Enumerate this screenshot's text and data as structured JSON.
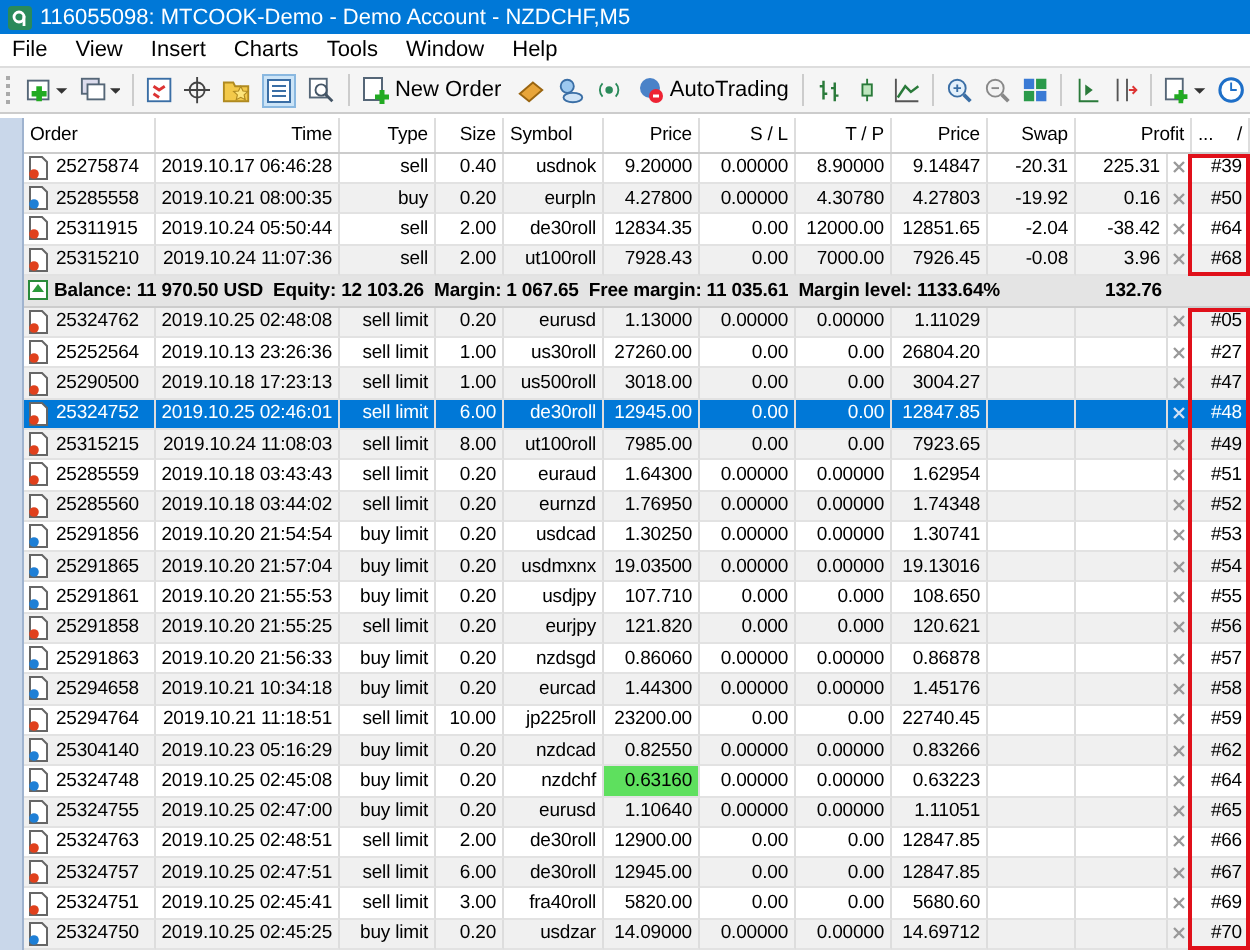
{
  "window": {
    "title": "116055098: MTCOOK-Demo - Demo Account - NZDCHF,M5"
  },
  "menu": [
    "File",
    "View",
    "Insert",
    "Charts",
    "Tools",
    "Window",
    "Help"
  ],
  "toolbar": {
    "new_order": "New Order",
    "auto_trading": "AutoTrading",
    "terminal_pressed": true
  },
  "table": {
    "columns": [
      "Order",
      "Time",
      "Type",
      "Size",
      "Symbol",
      "Price",
      "S / L",
      "T / P",
      "Price",
      "Swap",
      "Profit",
      "..."
    ],
    "sort_marker": "/",
    "open_positions": [
      {
        "order": "25275874",
        "time": "2019.10.17 06:46:28",
        "type": "sell",
        "kind": "sell",
        "size": "0.40",
        "symbol": "usdnok",
        "price": "9.20000",
        "sl": "0.00000",
        "tp": "8.90000",
        "current": "9.14847",
        "swap": "-20.31",
        "profit": "225.31",
        "comment": "#39"
      },
      {
        "order": "25285558",
        "time": "2019.10.21 08:00:35",
        "type": "buy",
        "kind": "buy",
        "size": "0.20",
        "symbol": "eurpln",
        "price": "4.27800",
        "sl": "0.00000",
        "tp": "4.30780",
        "current": "4.27803",
        "swap": "-19.92",
        "profit": "0.16",
        "comment": "#50"
      },
      {
        "order": "25311915",
        "time": "2019.10.24 05:50:44",
        "type": "sell",
        "kind": "sell",
        "size": "2.00",
        "symbol": "de30roll",
        "price": "12834.35",
        "sl": "0.00",
        "tp": "12000.00",
        "current": "12851.65",
        "swap": "-2.04",
        "profit": "-38.42",
        "comment": "#64"
      },
      {
        "order": "25315210",
        "time": "2019.10.24 11:07:36",
        "type": "sell",
        "kind": "sell",
        "size": "2.00",
        "symbol": "ut100roll",
        "price": "7928.43",
        "sl": "0.00",
        "tp": "7000.00",
        "current": "7926.45",
        "swap": "-0.08",
        "profit": "3.96",
        "comment": "#68"
      }
    ],
    "balance": {
      "text": "Balance: 11 970.50 USD  Equity: 12 103.26  Margin: 1 067.65  Free margin: 11 035.61  Margin level: 1133.64%",
      "profit": "132.76"
    },
    "pending_orders": [
      {
        "order": "25324762",
        "time": "2019.10.25 02:48:08",
        "type": "sell limit",
        "kind": "sell",
        "size": "0.20",
        "symbol": "eurusd",
        "price": "1.13000",
        "sl": "0.00000",
        "tp": "0.00000",
        "current": "1.11029",
        "comment": "#05",
        "selected": false,
        "price_flash": false
      },
      {
        "order": "25252564",
        "time": "2019.10.13 23:26:36",
        "type": "sell limit",
        "kind": "sell",
        "size": "1.00",
        "symbol": "us30roll",
        "price": "27260.00",
        "sl": "0.00",
        "tp": "0.00",
        "current": "26804.20",
        "comment": "#27",
        "selected": false,
        "price_flash": false
      },
      {
        "order": "25290500",
        "time": "2019.10.18 17:23:13",
        "type": "sell limit",
        "kind": "sell",
        "size": "1.00",
        "symbol": "us500roll",
        "price": "3018.00",
        "sl": "0.00",
        "tp": "0.00",
        "current": "3004.27",
        "comment": "#47",
        "selected": false,
        "price_flash": false
      },
      {
        "order": "25324752",
        "time": "2019.10.25 02:46:01",
        "type": "sell limit",
        "kind": "sell",
        "size": "6.00",
        "symbol": "de30roll",
        "price": "12945.00",
        "sl": "0.00",
        "tp": "0.00",
        "current": "12847.85",
        "comment": "#48",
        "selected": true,
        "price_flash": false
      },
      {
        "order": "25315215",
        "time": "2019.10.24 11:08:03",
        "type": "sell limit",
        "kind": "sell",
        "size": "8.00",
        "symbol": "ut100roll",
        "price": "7985.00",
        "sl": "0.00",
        "tp": "0.00",
        "current": "7923.65",
        "comment": "#49",
        "selected": false,
        "price_flash": false
      },
      {
        "order": "25285559",
        "time": "2019.10.18 03:43:43",
        "type": "sell limit",
        "kind": "sell",
        "size": "0.20",
        "symbol": "euraud",
        "price": "1.64300",
        "sl": "0.00000",
        "tp": "0.00000",
        "current": "1.62954",
        "comment": "#51",
        "selected": false,
        "price_flash": false
      },
      {
        "order": "25285560",
        "time": "2019.10.18 03:44:02",
        "type": "sell limit",
        "kind": "sell",
        "size": "0.20",
        "symbol": "eurnzd",
        "price": "1.76950",
        "sl": "0.00000",
        "tp": "0.00000",
        "current": "1.74348",
        "comment": "#52",
        "selected": false,
        "price_flash": false
      },
      {
        "order": "25291856",
        "time": "2019.10.20 21:54:54",
        "type": "buy limit",
        "kind": "buy",
        "size": "0.20",
        "symbol": "usdcad",
        "price": "1.30250",
        "sl": "0.00000",
        "tp": "0.00000",
        "current": "1.30741",
        "comment": "#53",
        "selected": false,
        "price_flash": false
      },
      {
        "order": "25291865",
        "time": "2019.10.20 21:57:04",
        "type": "buy limit",
        "kind": "buy",
        "size": "0.20",
        "symbol": "usdmxnx",
        "price": "19.03500",
        "sl": "0.00000",
        "tp": "0.00000",
        "current": "19.13016",
        "comment": "#54",
        "selected": false,
        "price_flash": false
      },
      {
        "order": "25291861",
        "time": "2019.10.20 21:55:53",
        "type": "buy limit",
        "kind": "buy",
        "size": "0.20",
        "symbol": "usdjpy",
        "price": "107.710",
        "sl": "0.000",
        "tp": "0.000",
        "current": "108.650",
        "comment": "#55",
        "selected": false,
        "price_flash": false
      },
      {
        "order": "25291858",
        "time": "2019.10.20 21:55:25",
        "type": "sell limit",
        "kind": "sell",
        "size": "0.20",
        "symbol": "eurjpy",
        "price": "121.820",
        "sl": "0.000",
        "tp": "0.000",
        "current": "120.621",
        "comment": "#56",
        "selected": false,
        "price_flash": false
      },
      {
        "order": "25291863",
        "time": "2019.10.20 21:56:33",
        "type": "buy limit",
        "kind": "buy",
        "size": "0.20",
        "symbol": "nzdsgd",
        "price": "0.86060",
        "sl": "0.00000",
        "tp": "0.00000",
        "current": "0.86878",
        "comment": "#57",
        "selected": false,
        "price_flash": false
      },
      {
        "order": "25294658",
        "time": "2019.10.21 10:34:18",
        "type": "buy limit",
        "kind": "buy",
        "size": "0.20",
        "symbol": "eurcad",
        "price": "1.44300",
        "sl": "0.00000",
        "tp": "0.00000",
        "current": "1.45176",
        "comment": "#58",
        "selected": false,
        "price_flash": false
      },
      {
        "order": "25294764",
        "time": "2019.10.21 11:18:51",
        "type": "sell limit",
        "kind": "sell",
        "size": "10.00",
        "symbol": "jp225roll",
        "price": "23200.00",
        "sl": "0.00",
        "tp": "0.00",
        "current": "22740.45",
        "comment": "#59",
        "selected": false,
        "price_flash": false
      },
      {
        "order": "25304140",
        "time": "2019.10.23 05:16:29",
        "type": "buy limit",
        "kind": "buy",
        "size": "0.20",
        "symbol": "nzdcad",
        "price": "0.82550",
        "sl": "0.00000",
        "tp": "0.00000",
        "current": "0.83266",
        "comment": "#62",
        "selected": false,
        "price_flash": false
      },
      {
        "order": "25324748",
        "time": "2019.10.25 02:45:08",
        "type": "buy limit",
        "kind": "buy",
        "size": "0.20",
        "symbol": "nzdchf",
        "price": "0.63160",
        "sl": "0.00000",
        "tp": "0.00000",
        "current": "0.63223",
        "comment": "#64",
        "selected": false,
        "price_flash": true
      },
      {
        "order": "25324755",
        "time": "2019.10.25 02:47:00",
        "type": "buy limit",
        "kind": "buy",
        "size": "0.20",
        "symbol": "eurusd",
        "price": "1.10640",
        "sl": "0.00000",
        "tp": "0.00000",
        "current": "1.11051",
        "comment": "#65",
        "selected": false,
        "price_flash": false
      },
      {
        "order": "25324763",
        "time": "2019.10.25 02:48:51",
        "type": "sell limit",
        "kind": "sell",
        "size": "2.00",
        "symbol": "de30roll",
        "price": "12900.00",
        "sl": "0.00",
        "tp": "0.00",
        "current": "12847.85",
        "comment": "#66",
        "selected": false,
        "price_flash": false
      },
      {
        "order": "25324757",
        "time": "2019.10.25 02:47:51",
        "type": "sell limit",
        "kind": "sell",
        "size": "6.00",
        "symbol": "de30roll",
        "price": "12945.00",
        "sl": "0.00",
        "tp": "0.00",
        "current": "12847.85",
        "comment": "#67",
        "selected": false,
        "price_flash": false
      },
      {
        "order": "25324751",
        "time": "2019.10.25 02:45:41",
        "type": "sell limit",
        "kind": "sell",
        "size": "3.00",
        "symbol": "fra40roll",
        "price": "5820.00",
        "sl": "0.00",
        "tp": "0.00",
        "current": "5680.60",
        "comment": "#69",
        "selected": false,
        "price_flash": false
      },
      {
        "order": "25324750",
        "time": "2019.10.25 02:45:25",
        "type": "buy limit",
        "kind": "buy",
        "size": "0.20",
        "symbol": "usdzar",
        "price": "14.09000",
        "sl": "0.00000",
        "tp": "0.00000",
        "current": "14.69712",
        "comment": "#70",
        "selected": false,
        "price_flash": false
      }
    ]
  }
}
